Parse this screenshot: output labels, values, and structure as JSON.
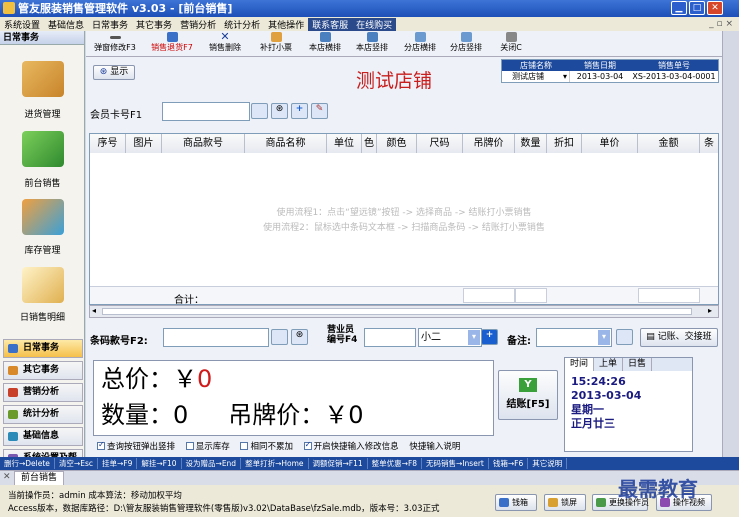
{
  "window": {
    "title": "管友服装销售管理软件 v3.03 - [前台销售]"
  },
  "menu": [
    "系统设置",
    "基础信息",
    "日常事务",
    "其它事务",
    "营销分析",
    "统计分析",
    "其他操作",
    "联系客服",
    "在线购买"
  ],
  "sidebar": {
    "header": "日常事务",
    "big_items": [
      "进货管理",
      "前台销售",
      "库存管理",
      "日销售明细"
    ],
    "nav": [
      "日常事务",
      "其它事务",
      "营销分析",
      "统计分析",
      "基础信息",
      "系统设置及帮..."
    ]
  },
  "toolbar": [
    "弹窗修改F3",
    "销售退货F7",
    "销售删除",
    "补打小票",
    "本店横排",
    "本店竖排",
    "分店横排",
    "分店竖排",
    "关闭C"
  ],
  "store": {
    "show_btn": "显示",
    "name_big": "测试店铺",
    "hdr_name": "店铺名称",
    "hdr_date": "销售日期",
    "hdr_no": "销售单号",
    "name_val": "测试店铺",
    "date_val": "2013-03-04",
    "no_val": "XS-2013-03-04-0001"
  },
  "member": {
    "label": "会员卡号F1"
  },
  "grid": {
    "columns": [
      "序号",
      "图片",
      "商品款号",
      "商品名称",
      "单位",
      "色",
      "颜色",
      "尺码",
      "吊牌价",
      "数量",
      "折扣",
      "单价",
      "金额",
      "条"
    ],
    "hint1": "使用流程1：点击“望远镜”按钮 -> 选择商品 -> 结账打小票销售",
    "hint2": "使用流程2：鼠标选中条码文本框 -> 扫描商品条码 -> 结账打小票销售",
    "total_label": "合计："
  },
  "barcode": {
    "label": "条码款号F2:",
    "seller_label1": "营业员",
    "seller_label2": "编号F4",
    "seller_val": "小二",
    "remark_label": "备注:",
    "record_btn": "记账、交接班"
  },
  "totals": {
    "price_label": "总价：",
    "price_sym": "￥",
    "price_val": "0",
    "qty_label": "数量：",
    "qty_val": "0",
    "tag_label": "吊牌价：",
    "tag_val": "￥0",
    "checkout_btn": "结账[F5]"
  },
  "options": [
    "查询按钮弹出竖排",
    "显示库存",
    "相同不累加",
    "开启快捷输入修改信息"
  ],
  "options_checked": [
    true,
    false,
    false,
    true
  ],
  "quick_help": "快捷输入说明",
  "clock": {
    "tabs": [
      "时间",
      "上单",
      "日售"
    ],
    "time": "15:24:26",
    "date": "2013-03-04",
    "weekday": "星期一",
    "lunar": "正月廿三"
  },
  "shortcuts": [
    "删行→Delete",
    "清空→Esc",
    "挂单→F9",
    "解挂→F10",
    "设为赠品→End",
    "整单打折→Home",
    "调额促销→F11",
    "整单优惠→F8",
    "无码销售→Insert",
    "钱箱→F6",
    "其它说明"
  ],
  "tab": "前台销售",
  "footer": {
    "operator": "当前操作员：admin  成本算法：移动加权平均",
    "version_line": "Access版本，数据库路径：D:\\管友服装销售管理软件(零售版)v3.02\\DataBase\\fzSale.mdb，版本号：3.03正式",
    "buttons": [
      "钱箱",
      "锁屏",
      "更换操作员",
      "操作视频"
    ],
    "watermark": "最需教育"
  }
}
